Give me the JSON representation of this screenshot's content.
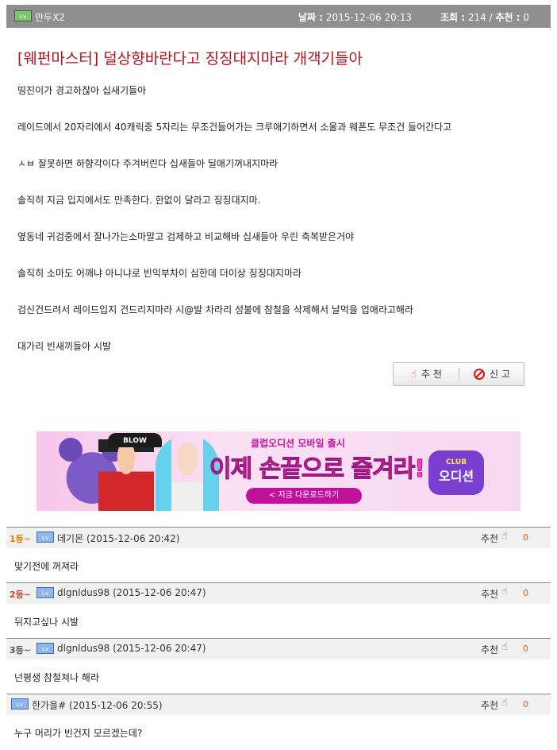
{
  "post": {
    "author": "만두X2",
    "date_label": "날짜 :",
    "date": "2015-12-06 20:13",
    "views_label": "조회 :",
    "views": "214",
    "separator": "/",
    "rec_label": "추천 :",
    "rec": "0",
    "title": "[웨펀마스터] 덜상향바란다고 징징대지마라 개객기들아",
    "lines": [
      "띵진이가 경고하잖아 십새기들아",
      "레이드에서 20자리에서 40캐릭중 5자리는 무조건들어가는 크루애기하면서 소울과 웨폰도 무조건 들어간다고",
      "ㅅㅂ 잘못하면 하향각이다 주겨버린다 십새들아 딜애기꺼내지마라",
      "솔직히 지금 입지에서도 만족한다.  한없이 달라고 징징대지마.",
      "옆동네 귀검중에서 잘나가는소마말고 검제하고 비교해바 십새들아 우린 축복받은거야",
      "솔직히 소마도 어깨냐 아니냐로 빈익부차이 심한데 더이상 징징대지마라",
      "검신건드려서 레이드입지 건드리지마라 시@발 차라리 성불에 참철을 삭제해서 날먹을 업애라고해라",
      "대가리 빈새끼들아 시발"
    ],
    "recommend_button": "추 천",
    "report_button": "신 고"
  },
  "banner": {
    "cap_text": "BLOW",
    "sub": "클럽오디션 모바일 출시",
    "headline": "이제 손끝으로 즐겨라!",
    "cta": "< 지금 다운로드하기",
    "logo_top": "CLUB",
    "logo_main": "오디션"
  },
  "comments": [
    {
      "rank": "1등~",
      "author": "데기몬",
      "date": "(2015-12-06 20:42)",
      "text": "맞기전에 꺼져라",
      "rec_label": "추천",
      "rec": "0"
    },
    {
      "rank": "2등~",
      "author": "dlgnldus98",
      "date": "(2015-12-06 20:47)",
      "text": "뒤지고싶나 시발",
      "rec_label": "추천",
      "rec": "0"
    },
    {
      "rank": "3등~",
      "author": "dlgnldus98",
      "date": "(2015-12-06 20:47)",
      "text": "넌평생 참철쳐나 해라",
      "rec_label": "추천",
      "rec": "0"
    },
    {
      "rank": "",
      "author": "한가을#",
      "date": "(2015-12-06 20:55)",
      "text": "누구 머리가 빈건지 모르겠는데?",
      "rec_label": "추천",
      "rec": "0"
    }
  ],
  "icons": {
    "level_badge": "level-badge-icon",
    "thumb": "thumbs-up-icon",
    "report": "no-entry-icon"
  },
  "colors": {
    "title": "#b5111b",
    "header_bg": "#8f8f8f",
    "count": "#e25b14",
    "banner_pink": "#ff3fb0"
  }
}
